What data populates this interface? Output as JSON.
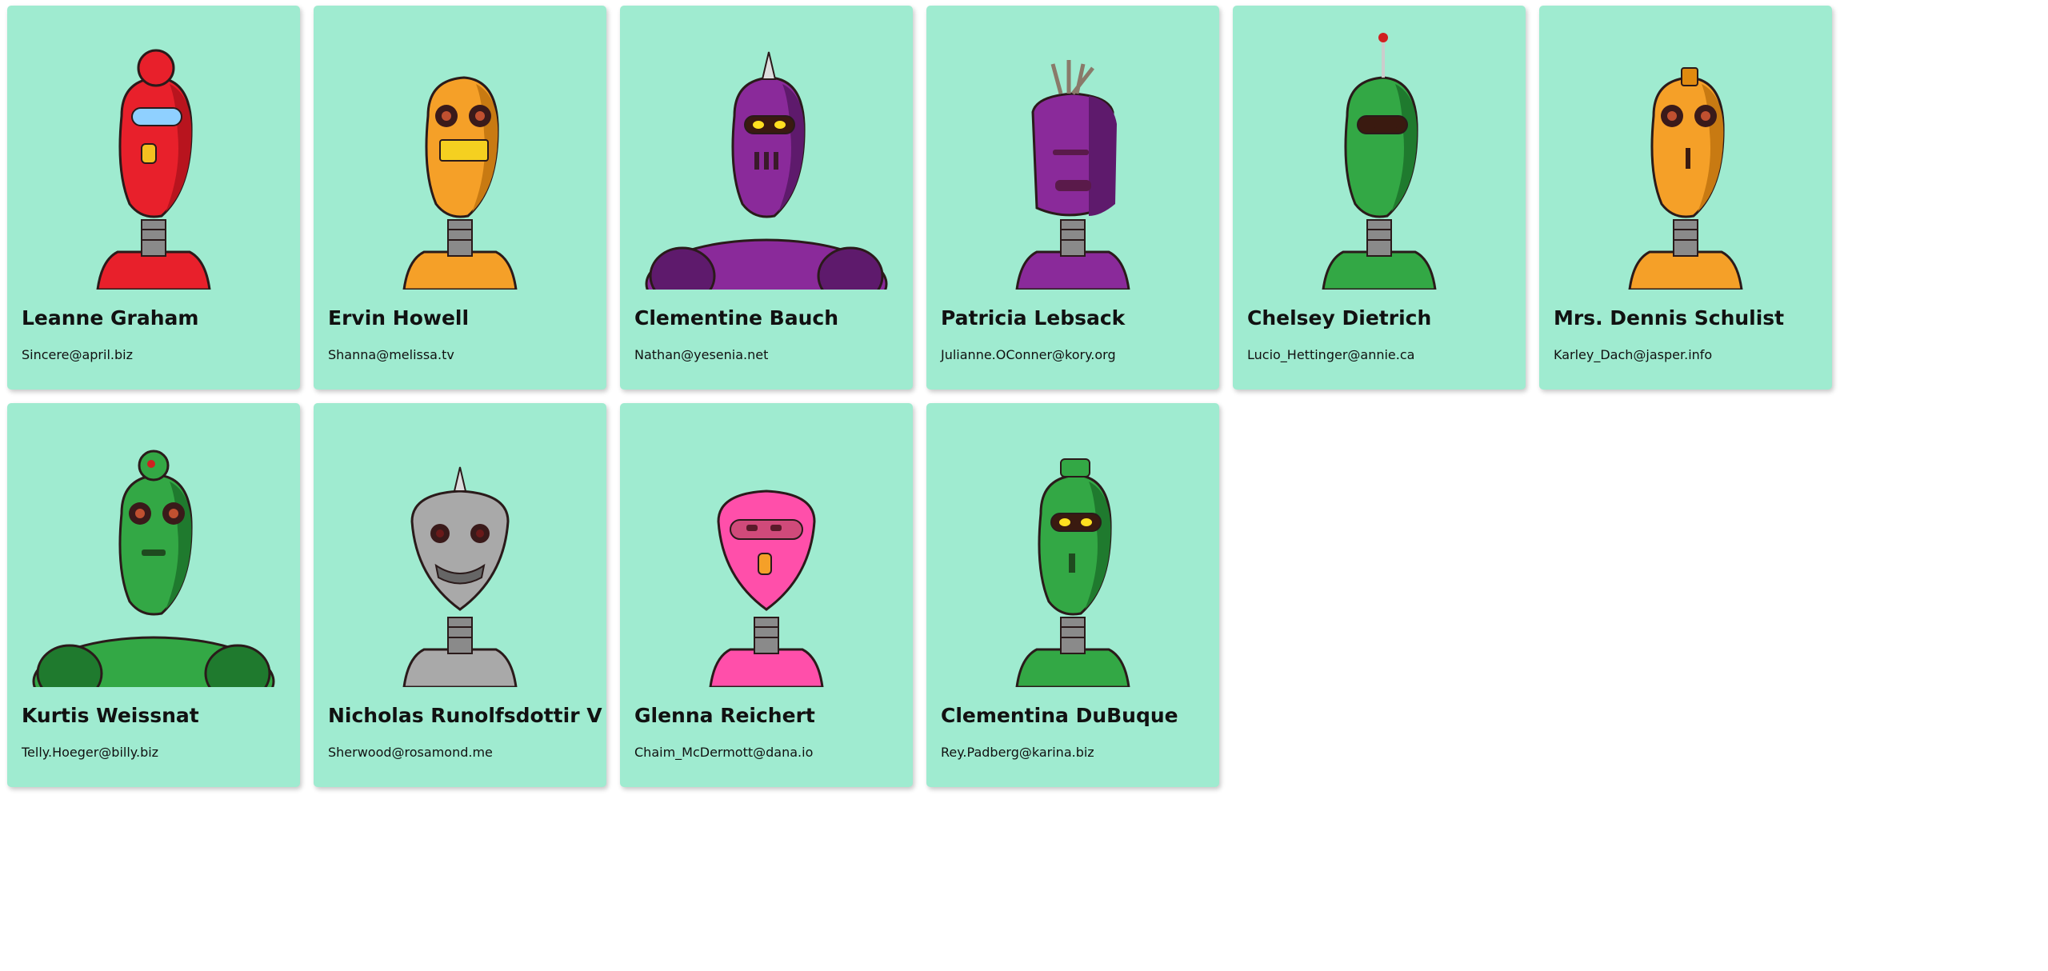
{
  "robots": [
    {
      "name": "Leanne Graham",
      "email": "Sincere@april.biz",
      "icon": "robot-avatar-icon",
      "color": "#e8202b",
      "shade": "#b8141e",
      "eye": "#8fd0ff",
      "style": "visor-tall"
    },
    {
      "name": "Ervin Howell",
      "email": "Shanna@melissa.tv",
      "icon": "robot-avatar-icon",
      "color": "#f5a028",
      "shade": "#c87a12",
      "eye": "#4a1a12",
      "style": "round-eyes-grille"
    },
    {
      "name": "Clementine Bauch",
      "email": "Nathan@yesenia.net",
      "icon": "robot-avatar-icon",
      "color": "#8a2a9a",
      "shade": "#5e1a6c",
      "eye": "#ffe020",
      "style": "spike-wide"
    },
    {
      "name": "Patricia Lebsack",
      "email": "Julianne.OConner@kory.org",
      "icon": "robot-avatar-icon",
      "color": "#8a2a9a",
      "shade": "#5e1a6c",
      "eye": "#5a1a4a",
      "style": "box-slit"
    },
    {
      "name": "Chelsey Dietrich",
      "email": "Lucio_Hettinger@annie.ca",
      "icon": "robot-avatar-icon",
      "color": "#33a845",
      "shade": "#1f7a2e",
      "eye": "#3a1a10",
      "style": "antenna-visor"
    },
    {
      "name": "Mrs. Dennis Schulist",
      "email": "Karley_Dach@jasper.info",
      "icon": "robot-avatar-icon",
      "color": "#f5a028",
      "shade": "#c87a12",
      "eye": "#4a1a12",
      "style": "round-eyes-slot"
    },
    {
      "name": "Kurtis Weissnat",
      "email": "Telly.Hoeger@billy.biz",
      "icon": "robot-avatar-icon",
      "color": "#33a845",
      "shade": "#1f7a2e",
      "eye": "#4a1a12",
      "style": "round-eyes-wide"
    },
    {
      "name": "Nicholas Runolfsdottir V",
      "email": "Sherwood@rosamond.me",
      "icon": "robot-avatar-icon",
      "color": "#a9a9a9",
      "shade": "#7a7a7a",
      "eye": "#6a1a1a",
      "style": "spike-round"
    },
    {
      "name": "Glenna Reichert",
      "email": "Chaim_McDermott@dana.io",
      "icon": "robot-avatar-icon",
      "color": "#ff4faa",
      "shade": "#d0207a",
      "eye": "#5a1a2a",
      "style": "visor-pink"
    },
    {
      "name": "Clementina DuBuque",
      "email": "Rey.Padberg@karina.biz",
      "icon": "robot-avatar-icon",
      "color": "#33a845",
      "shade": "#1f7a2e",
      "eye": "#ffe020",
      "style": "hat-visor"
    }
  ]
}
